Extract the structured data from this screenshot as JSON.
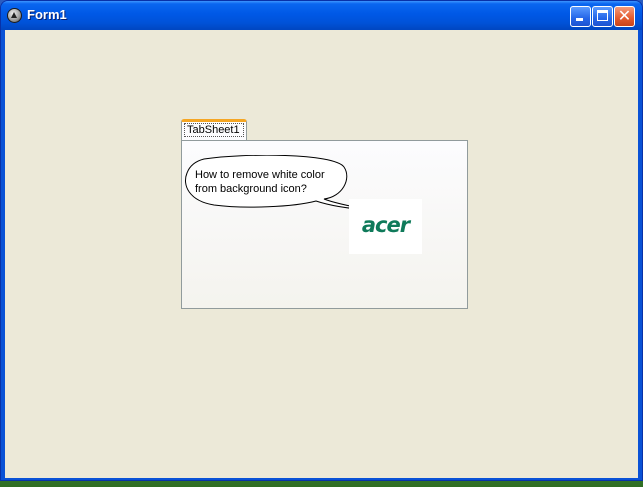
{
  "window": {
    "title": "Form1"
  },
  "titlebar_buttons": {
    "minimize": "minimize",
    "maximize": "maximize",
    "close": "close"
  },
  "tabs": [
    {
      "label": "TabSheet1"
    }
  ],
  "tab_content": {
    "bubble_text": "How to remove white color from background icon?",
    "logo": "acer"
  },
  "colors": {
    "title_bar": "#0058e6",
    "client_background": "#ece9d8",
    "tab_accent": "#f5a623",
    "logo_green": "#0f7a5a"
  },
  "icons": [
    "app-icon",
    "minimize-icon",
    "maximize-icon",
    "close-icon"
  ]
}
